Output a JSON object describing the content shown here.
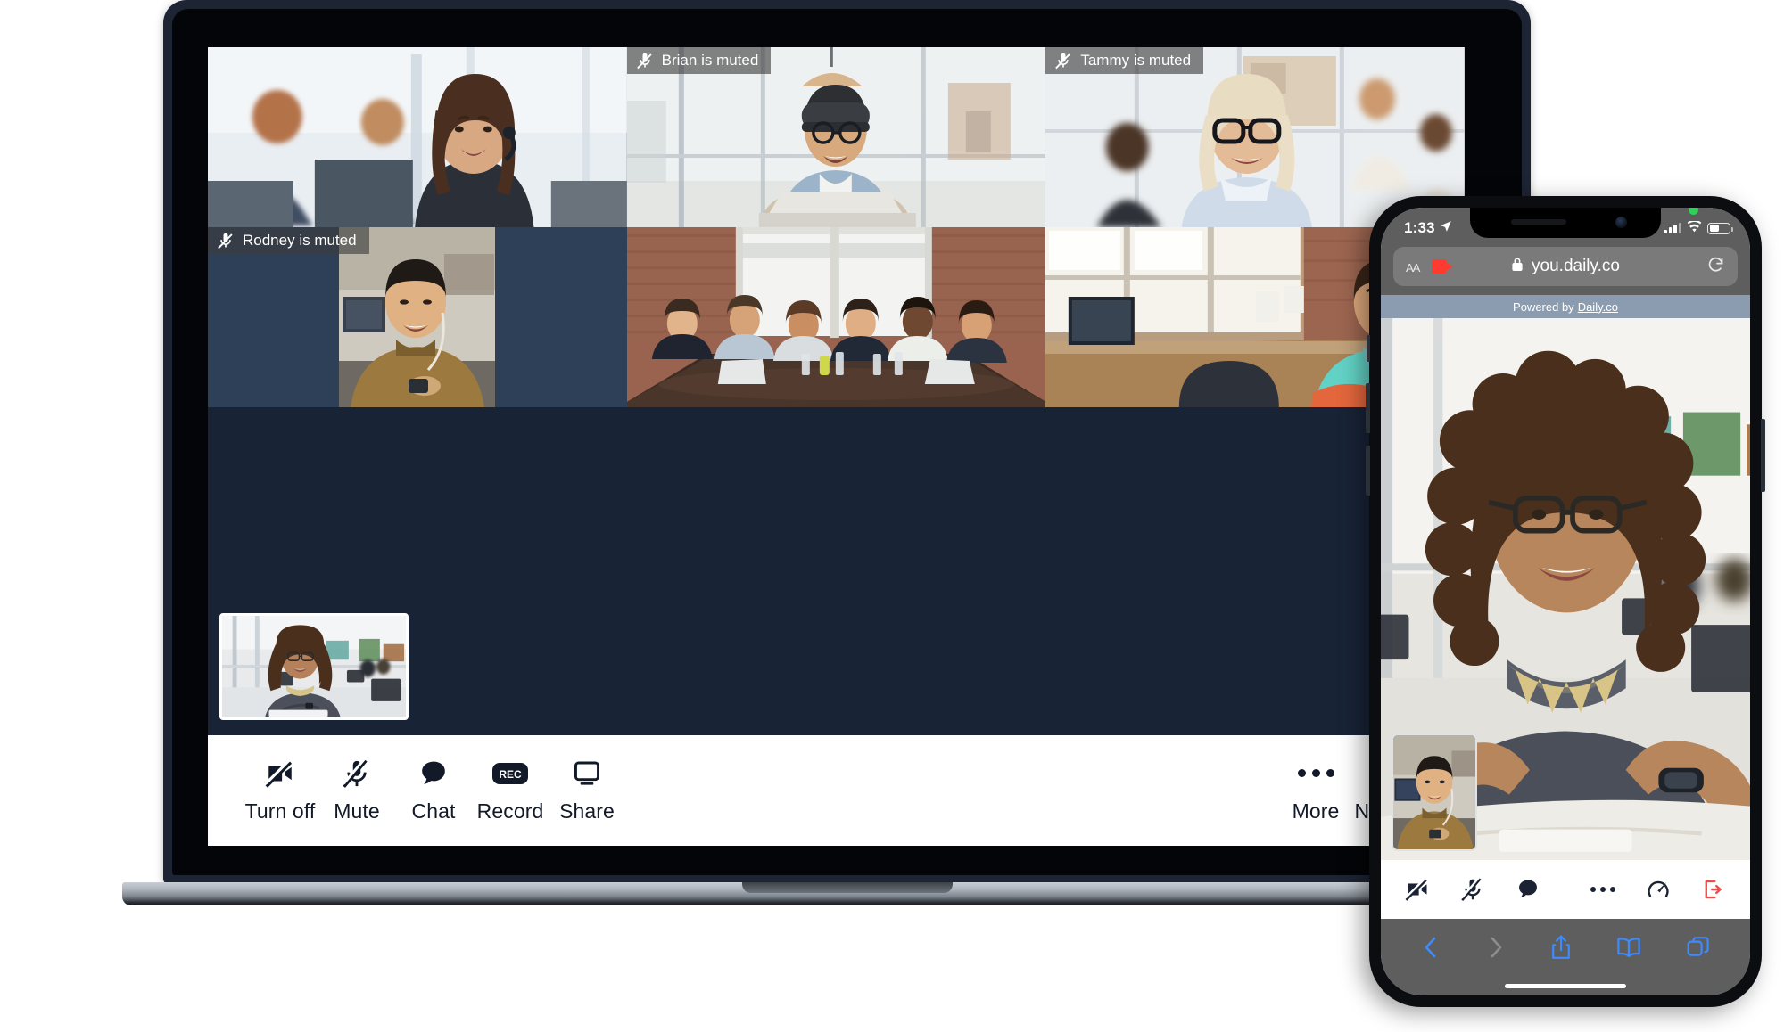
{
  "laptop": {
    "participants": [
      {
        "id": "p1",
        "name": "",
        "muted": false,
        "badge": ""
      },
      {
        "id": "p2",
        "name": "Brian",
        "muted": true,
        "badge": "Brian is muted"
      },
      {
        "id": "p3",
        "name": "Tammy",
        "muted": true,
        "badge": "Tammy is muted"
      },
      {
        "id": "p4",
        "name": "Rodney",
        "muted": true,
        "badge": "Rodney is muted"
      },
      {
        "id": "p5",
        "name": "",
        "muted": false,
        "badge": ""
      },
      {
        "id": "p6",
        "name": "",
        "muted": false,
        "badge": ""
      }
    ],
    "toolbar": {
      "left": [
        {
          "icon": "camera-off-icon",
          "label": "Turn off"
        },
        {
          "icon": "mic-off-icon",
          "label": "Mute"
        },
        {
          "icon": "chat-bubble-icon",
          "label": "Chat"
        },
        {
          "icon": "record-icon",
          "label": "Record"
        },
        {
          "icon": "screen-share-icon",
          "label": "Share"
        }
      ],
      "right": [
        {
          "icon": "more-dots-icon",
          "label": "More"
        },
        {
          "icon": "network-gauge-icon",
          "label": "Network"
        }
      ]
    }
  },
  "phone": {
    "status": {
      "time": "1:33",
      "location_icon": "location-arrow-icon",
      "camera_in_use_icon": "green-recording-dot-icon",
      "cellular_icon": "cellular-bars-icon",
      "wifi_icon": "wifi-icon",
      "battery_icon": "battery-icon"
    },
    "browser": {
      "text_size_label": "AA",
      "camera_active_icon": "red-camera-icon",
      "lock_icon": "lock-icon",
      "url": "you.daily.co",
      "reload_icon": "reload-icon"
    },
    "banner": {
      "prefix": "Powered by ",
      "link": "Daily.co"
    },
    "call_toolbar": {
      "left": [
        {
          "icon": "camera-off-icon",
          "label": "Turn camera off"
        },
        {
          "icon": "mic-off-icon",
          "label": "Mute"
        },
        {
          "icon": "chat-bubble-icon",
          "label": "Chat"
        }
      ],
      "right": [
        {
          "icon": "more-dots-icon",
          "label": "More"
        },
        {
          "icon": "network-gauge-icon",
          "label": "Network"
        },
        {
          "icon": "leave-call-icon",
          "label": "Leave",
          "color": "#ef4b4b"
        }
      ]
    },
    "safari_nav": [
      {
        "icon": "back-chevron-icon",
        "label": "Back",
        "enabled": true
      },
      {
        "icon": "forward-chevron-icon",
        "label": "Forward",
        "enabled": false
      },
      {
        "icon": "share-icon",
        "label": "Share",
        "enabled": true
      },
      {
        "icon": "bookmarks-icon",
        "label": "Bookmarks",
        "enabled": true
      },
      {
        "icon": "tabs-icon",
        "label": "Tabs",
        "enabled": true
      }
    ]
  },
  "colors": {
    "stage_bg": "#182336",
    "tile_bg": "#2e4057",
    "toolbar_bg": "#ffffff",
    "toolbar_fg": "#121a29",
    "badge_bg": "rgba(60,60,60,0.62)",
    "accent_red": "#ef4b4b",
    "safari_chrome": "#5e5e5e",
    "banner_bg": "#8c9cb0",
    "safari_blue": "#3d8bfd",
    "camera_red": "#ff3b30"
  }
}
